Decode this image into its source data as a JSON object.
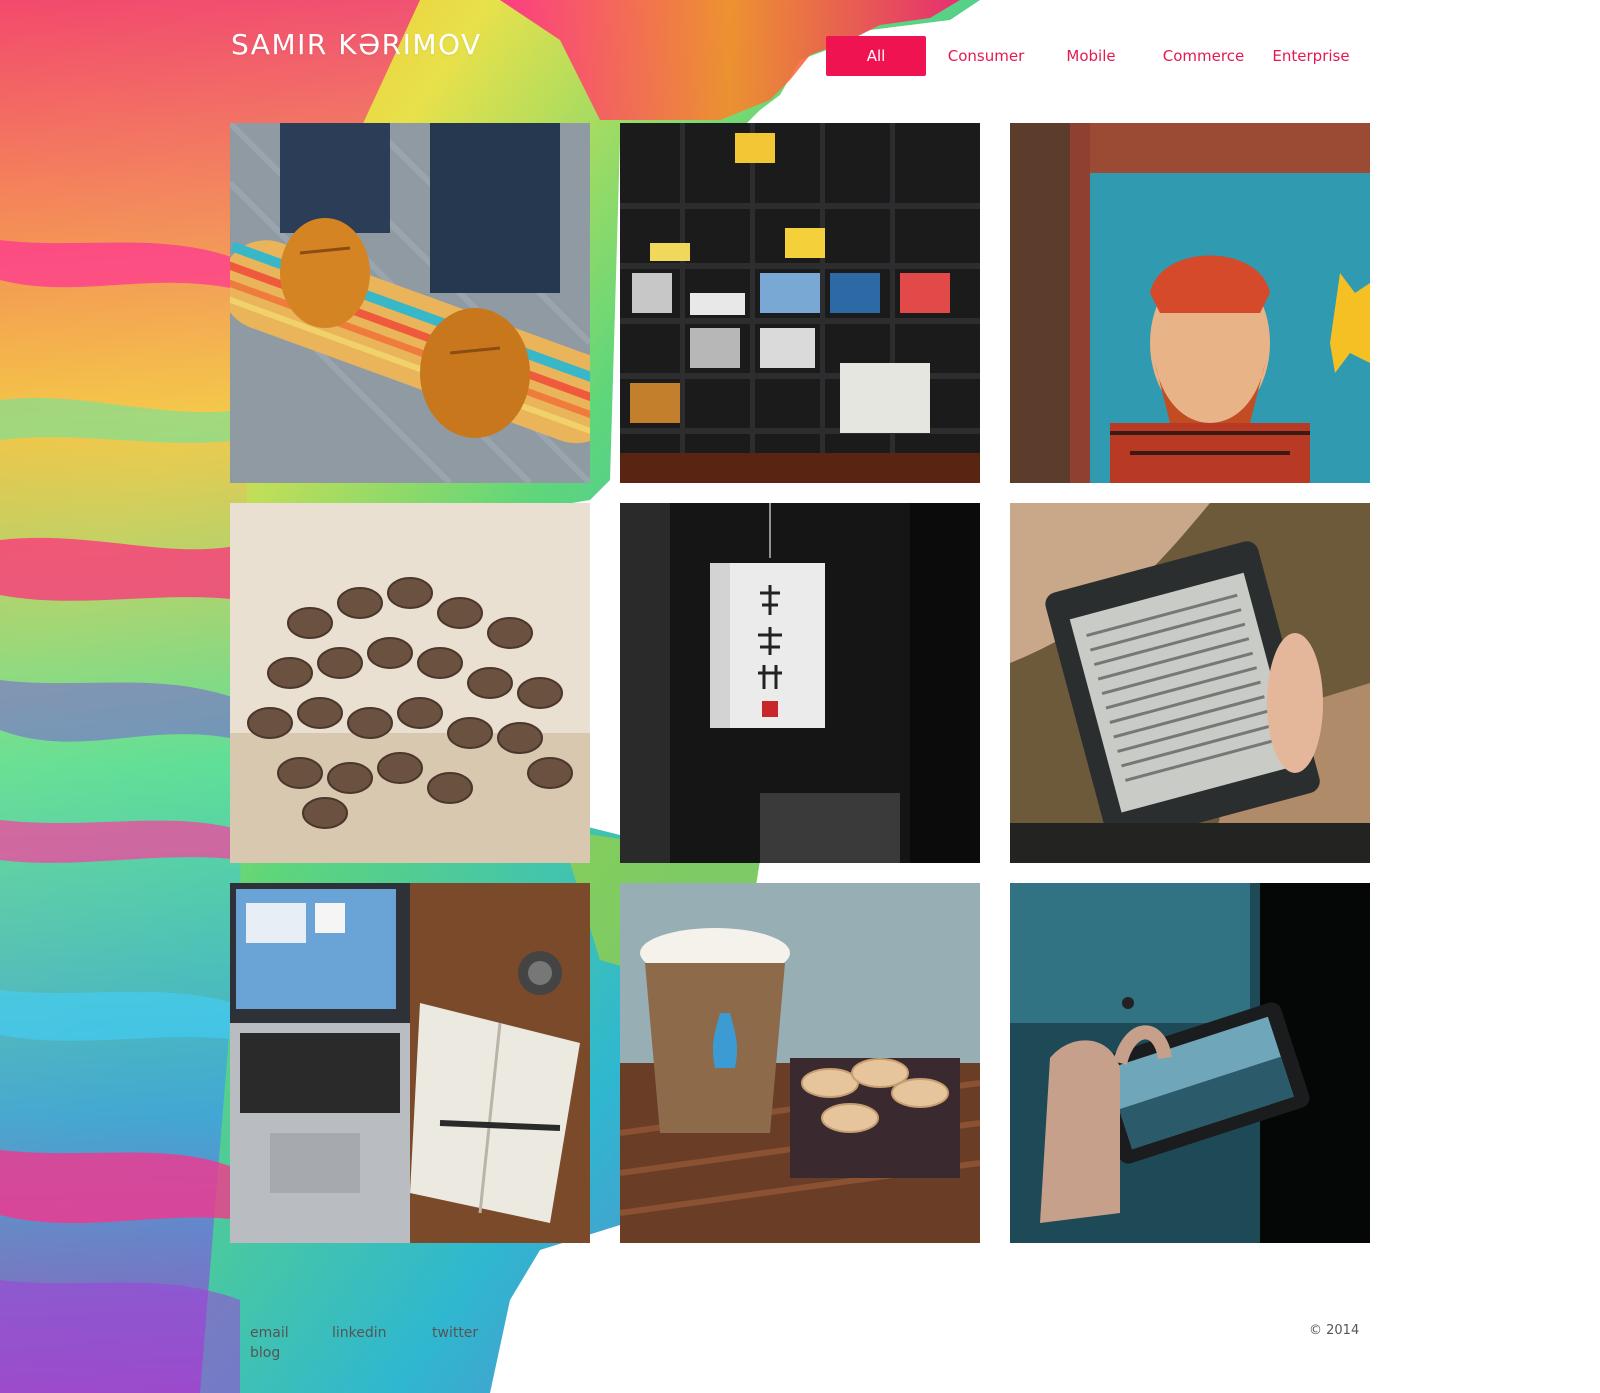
{
  "header": {
    "brand": "SAMIR KƏRIMOV",
    "filters": [
      {
        "label": "All",
        "active": true
      },
      {
        "label": "Consumer",
        "active": false
      },
      {
        "label": "Mobile",
        "active": false
      },
      {
        "label": "Commerce",
        "active": false
      },
      {
        "label": "Enterprise",
        "active": false
      }
    ]
  },
  "colors": {
    "accent": "#ef1351",
    "accent_text": "#e5194f",
    "footer_text": "#555555"
  },
  "gallery": {
    "items": [
      {
        "subject": "feet-on-skateboard"
      },
      {
        "subject": "bookshelf"
      },
      {
        "subject": "bearded-man-mural"
      },
      {
        "subject": "coffee-beans"
      },
      {
        "subject": "hanging-paper-lantern"
      },
      {
        "subject": "hand-holding-ereader"
      },
      {
        "subject": "laptop-and-notebook"
      },
      {
        "subject": "coffee-cup-and-macarons"
      },
      {
        "subject": "hands-holding-phone"
      }
    ]
  },
  "footer": {
    "links": {
      "email": "email",
      "linkedin": "linkedin",
      "twitter": "twitter",
      "blog": "blog"
    },
    "copyright": "© 2014"
  }
}
